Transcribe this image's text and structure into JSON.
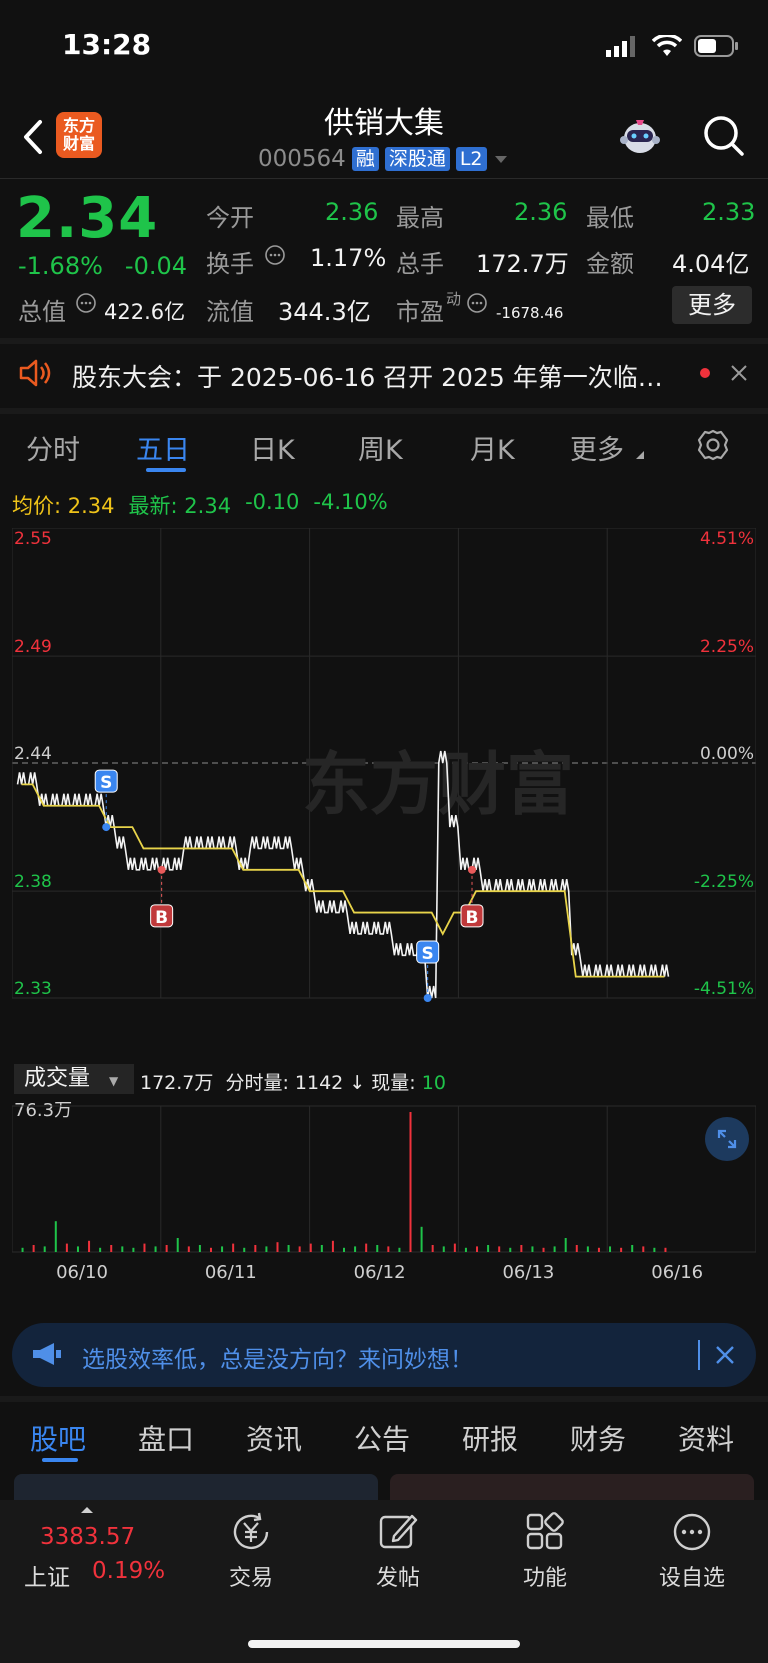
{
  "status": {
    "time": "13:28"
  },
  "header": {
    "logo_line1": "东方",
    "logo_line2": "财富",
    "stock_name": "供销大集",
    "stock_code": "000564",
    "tags": [
      "融",
      "深股通",
      "L2"
    ]
  },
  "quote": {
    "price": "2.34",
    "change_pct": "-1.68%",
    "change": "-0.04",
    "fields": {
      "open_label": "今开",
      "open": "2.36",
      "high_label": "最高",
      "high": "2.36",
      "low_label": "最低",
      "low": "2.33",
      "turnover_label": "换手",
      "turnover": "1.17%",
      "volume_label": "总手",
      "volume": "172.7万",
      "amount_label": "金额",
      "amount": "4.04亿",
      "mcap_label": "总值",
      "mcap": "422.6亿",
      "float_label": "流值",
      "float": "344.3亿",
      "pe_label": "市盈",
      "pe_sup": "动",
      "pe": "-1678.46"
    },
    "more_label": "更多"
  },
  "notice": {
    "text": "股东大会：于 2025-06-16 召开 2025 年第一次临…"
  },
  "chart_tabs": [
    "分时",
    "五日",
    "日K",
    "周K",
    "月K",
    "更多"
  ],
  "chart_header": {
    "avg_label": "均价:",
    "avg": "2.34",
    "latest_label": "最新:",
    "latest": "2.34",
    "latest_change": "-0.10",
    "latest_pct": "-4.10%"
  },
  "chart_data": {
    "type": "line",
    "y_ticks": [
      "2.55",
      "2.49",
      "2.44",
      "2.38",
      "2.33"
    ],
    "y_pct_ticks": [
      "4.51%",
      "2.25%",
      "0.00%",
      "-2.25%",
      "-4.51%"
    ],
    "ylim": [
      2.33,
      2.55
    ],
    "watermark": "东方财富",
    "x_labels": [
      "06/10",
      "06/11",
      "06/12",
      "06/13",
      "06/16"
    ],
    "markers": [
      "S",
      "B",
      "S",
      "B"
    ],
    "series": [
      {
        "values": [
          2.43,
          2.43,
          2.42,
          2.42,
          2.42,
          2.42,
          2.42,
          2.42,
          2.41,
          2.4,
          2.39,
          2.39,
          2.39,
          2.39,
          2.39,
          2.4,
          2.4,
          2.4,
          2.4,
          2.4,
          2.39,
          2.4,
          2.4,
          2.4,
          2.4,
          2.39,
          2.38,
          2.37,
          2.37,
          2.37,
          2.36,
          2.36,
          2.36,
          2.36,
          2.35,
          2.35,
          2.35,
          2.33,
          2.44,
          2.41,
          2.39,
          2.39,
          2.38,
          2.38,
          2.38,
          2.38,
          2.38,
          2.38,
          2.38,
          2.38,
          2.35,
          2.34,
          2.34,
          2.34,
          2.34,
          2.34,
          2.34,
          2.34,
          2.34
        ]
      },
      {
        "values": [
          2.43,
          2.43,
          2.42,
          2.42,
          2.42,
          2.42,
          2.42,
          2.42,
          2.41,
          2.41,
          2.41,
          2.4,
          2.4,
          2.4,
          2.4,
          2.4,
          2.4,
          2.4,
          2.4,
          2.4,
          2.39,
          2.39,
          2.39,
          2.39,
          2.39,
          2.39,
          2.38,
          2.38,
          2.38,
          2.38,
          2.37,
          2.37,
          2.37,
          2.37,
          2.37,
          2.37,
          2.37,
          2.37,
          2.36,
          2.37,
          2.37,
          2.38,
          2.38,
          2.38,
          2.38,
          2.38,
          2.38,
          2.38,
          2.38,
          2.38,
          2.34,
          2.34,
          2.34,
          2.34,
          2.34,
          2.34,
          2.34,
          2.34,
          2.34
        ]
      }
    ]
  },
  "volume": {
    "label": "成交量",
    "total": "172.7万",
    "minute_label": "分时量:",
    "minute": "1142",
    "now_label": "现量:",
    "now": "10",
    "max": "76.3万",
    "bars": [
      3,
      5,
      4,
      22,
      6,
      4,
      8,
      3,
      5,
      4,
      3,
      6,
      4,
      5,
      10,
      4,
      5,
      3,
      4,
      6,
      3,
      5,
      4,
      7,
      5,
      4,
      6,
      5,
      8,
      3,
      4,
      6,
      5,
      4,
      3,
      100,
      18,
      5,
      4,
      6,
      3,
      4,
      5,
      4,
      3,
      5,
      4,
      3,
      4,
      10,
      5,
      4,
      3,
      4,
      3,
      5,
      4,
      3,
      3
    ],
    "bar_dirs": [
      "g",
      "r",
      "g",
      "g",
      "r",
      "g",
      "r",
      "g",
      "r",
      "g",
      "g",
      "r",
      "g",
      "r",
      "g",
      "r",
      "g",
      "r",
      "g",
      "r",
      "g",
      "r",
      "g",
      "r",
      "g",
      "r",
      "r",
      "g",
      "r",
      "g",
      "g",
      "r",
      "g",
      "r",
      "g",
      "r",
      "g",
      "r",
      "g",
      "r",
      "g",
      "r",
      "g",
      "r",
      "g",
      "r",
      "g",
      "r",
      "g",
      "g",
      "r",
      "g",
      "r",
      "g",
      "r",
      "g",
      "r",
      "g",
      "r"
    ]
  },
  "ad": {
    "text": "选股效率低，总是没方向？来问妙想！"
  },
  "bottom_tabs": [
    "股吧",
    "盘口",
    "资讯",
    "公告",
    "研报",
    "财务",
    "资料"
  ],
  "dock": {
    "index_value": "3383.57",
    "index_name": "上证",
    "index_pct": "0.19%",
    "items": [
      "交易",
      "发帖",
      "功能",
      "设自选"
    ]
  },
  "colors": {
    "up": "#f0323c",
    "down": "#1fc44a",
    "accent": "#3a86f0",
    "avg_line": "#e8d44a"
  }
}
